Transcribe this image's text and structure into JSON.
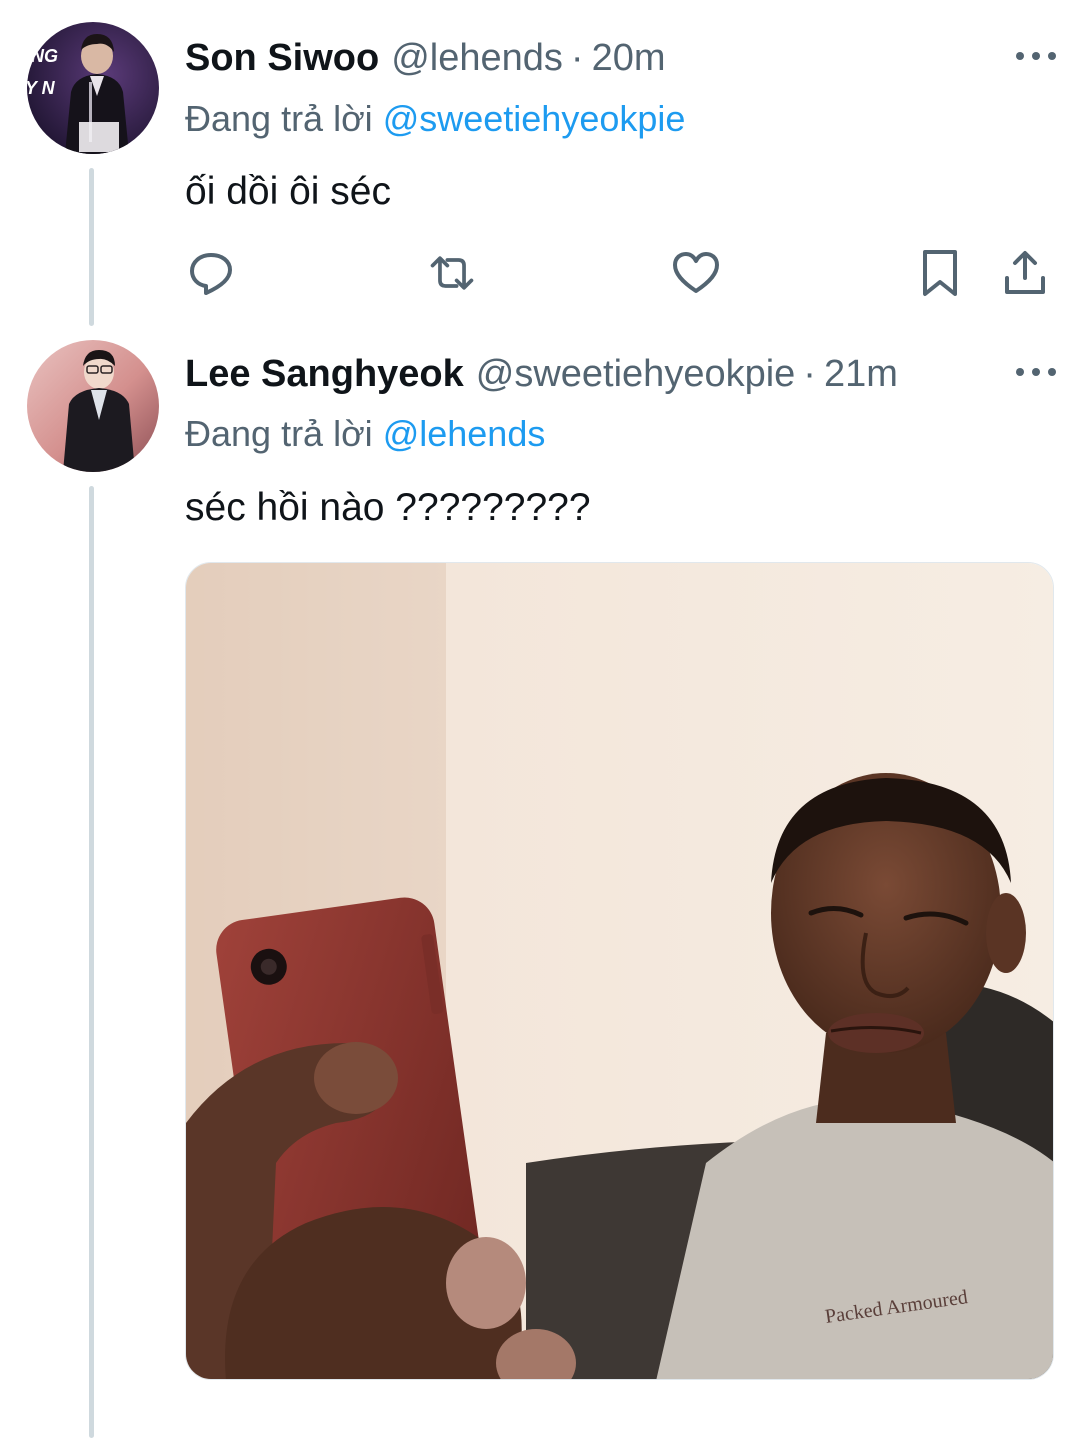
{
  "tweets": [
    {
      "display_name": "Son Siwoo",
      "handle": "@lehends",
      "separator": "·",
      "time": "20m",
      "reply_prefix": "Đang trả lời",
      "reply_mention": "@sweetiehyeokpie",
      "text": "ối dồi ôi séc",
      "avatar_text_lines": [
        "NG",
        "Y N"
      ]
    },
    {
      "display_name": "Lee Sanghyeok",
      "handle": "@sweetiehyeokpie",
      "separator": "·",
      "time": "21m",
      "reply_prefix": "Đang trả lời",
      "reply_mention": "@lehends",
      "text": "séc hồi nào ?????????",
      "media": {
        "type": "photo",
        "shirt_print": "Packed Armoured"
      }
    }
  ],
  "actions": [
    {
      "name": "reply",
      "icon": "speech-bubble-icon"
    },
    {
      "name": "retweet",
      "icon": "retweet-icon"
    },
    {
      "name": "like",
      "icon": "heart-icon"
    },
    {
      "name": "bookmark",
      "icon": "bookmark-icon"
    },
    {
      "name": "share",
      "icon": "share-icon"
    }
  ],
  "colors": {
    "text_primary": "#0f1419",
    "text_secondary": "#536471",
    "link": "#1d9bf0",
    "thread_line": "#cfd9de"
  }
}
